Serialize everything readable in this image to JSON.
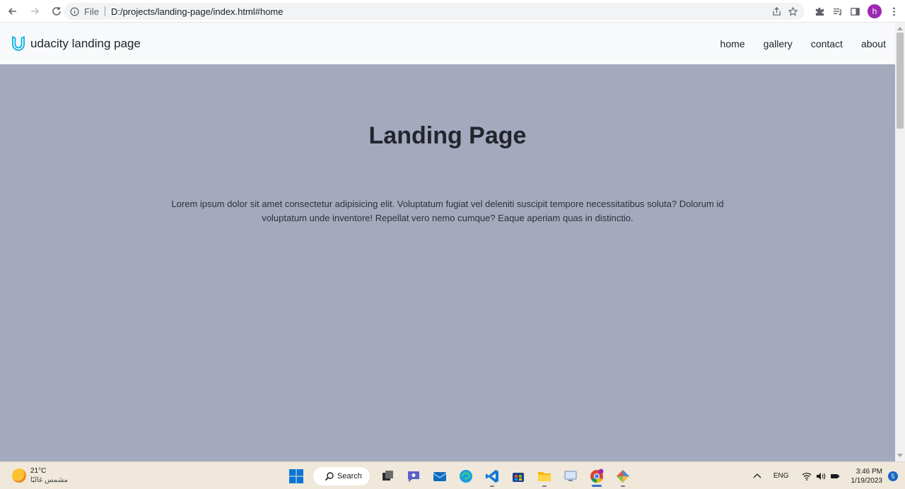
{
  "browser": {
    "omnibox": {
      "scheme_label": "File",
      "url": "D:/projects/landing-page/index.html#home"
    },
    "profile_initial": "h"
  },
  "site": {
    "brand": "udacity landing page",
    "nav": [
      {
        "label": "home"
      },
      {
        "label": "gallery"
      },
      {
        "label": "contact"
      },
      {
        "label": "about"
      }
    ],
    "hero": {
      "title": "Landing Page",
      "text": "Lorem ipsum dolor sit amet consectetur adipisicing elit. Voluptatum fugiat vel deleniti suscipit tempore necessitatibus soluta? Dolorum id voluptatum unde inventore! Repellat vero nemo cumque? Eaque aperiam quas in distinctio."
    },
    "colors": {
      "hero_bg": "#a5a9be",
      "navbar_bg": "#f8f9fa",
      "logo_accent": "#02b3e4"
    }
  },
  "taskbar": {
    "weather": {
      "temp": "21°C",
      "desc": "مشمس غالبًا"
    },
    "search_label": "Search",
    "language": "ENG",
    "time": "3:46 PM",
    "date": "1/19/2023",
    "notification_count": "5"
  }
}
